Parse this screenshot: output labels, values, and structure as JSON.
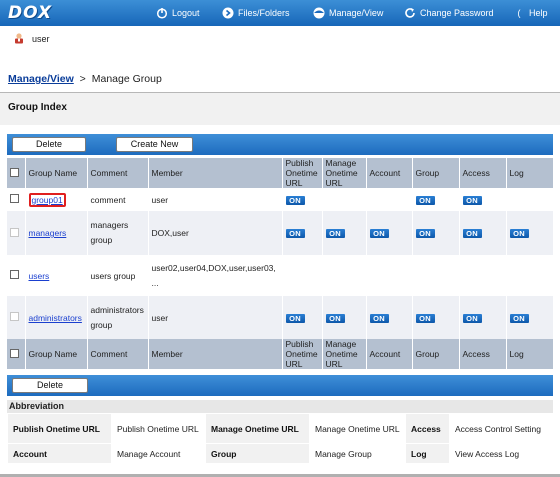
{
  "header": {
    "logo": "DOX",
    "nav": [
      {
        "label": "Logout",
        "icon": "logout-icon"
      },
      {
        "label": "Files/Folders",
        "icon": "folders-icon"
      },
      {
        "label": "Manage/View",
        "icon": "manage-icon"
      },
      {
        "label": "Change Password",
        "icon": "refresh-icon"
      },
      {
        "label": "Help",
        "icon": "help-icon"
      }
    ]
  },
  "user": {
    "name": "user",
    "icon": "user-icon"
  },
  "breadcrumb": {
    "link": "Manage/View",
    "separator": ">",
    "current": "Manage Group"
  },
  "section_title": "Group Index",
  "top_buttons": {
    "delete": "Delete",
    "create": "Create New"
  },
  "bottom_buttons": {
    "delete": "Delete"
  },
  "table": {
    "headers": {
      "group_name": "Group Name",
      "comment": "Comment",
      "member": "Member",
      "publish_line1": "Publish",
      "publish_line2": "Onetime",
      "publish_line3": "URL",
      "manage_line1": "Manage",
      "manage_line2": "Onetime",
      "manage_line3": "URL",
      "account": "Account",
      "group": "Group",
      "access": "Access",
      "log": "Log"
    },
    "rows": [
      {
        "name": "group01",
        "comment": "comment",
        "member": "user"
      },
      {
        "name": "managers",
        "comment_line1": "managers",
        "comment_line2": "group",
        "member": "DOX,user"
      },
      {
        "name": "users",
        "comment": "users group",
        "member_line1": "user02,user04,DOX,user,user03,",
        "member_line2": "..."
      },
      {
        "name": "administrators",
        "comment_line1": "administrators",
        "comment_line2": "group",
        "member": "user"
      }
    ],
    "on_label": "ON"
  },
  "abbreviation": {
    "title": "Abbreviation",
    "publish_key": "Publish Onetime URL",
    "publish_val": "Publish Onetime URL",
    "manage_key": "Manage Onetime URL",
    "manage_val": "Manage Onetime URL",
    "access_key": "Access",
    "access_val": "Access Control Setting",
    "account_key": "Account",
    "account_val": "Manage Account",
    "group_key": "Group",
    "group_val": "Manage Group",
    "log_key": "Log",
    "log_val": "View Access Log"
  },
  "colors": {
    "header_blue": "#1e6dbf",
    "table_header": "#b4c0d0",
    "highlight": "#e01f1f",
    "on_badge": "#1565c0"
  }
}
